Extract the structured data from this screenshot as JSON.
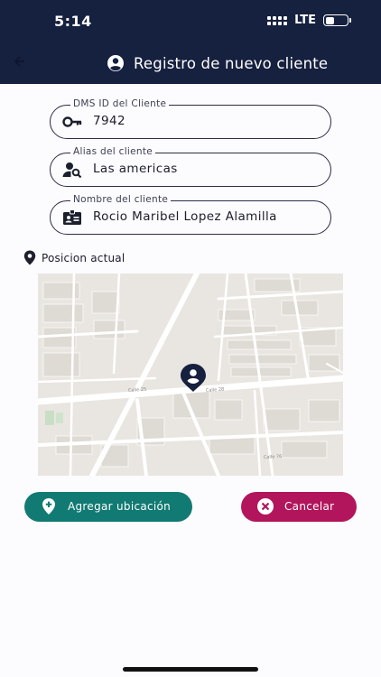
{
  "status_bar": {
    "time": "5:14",
    "network": "LTE",
    "battery_level": 0.3
  },
  "header": {
    "title": "Registro de nuevo cliente",
    "back_icon": "arrow-left-icon",
    "title_icon": "account-circle-icon"
  },
  "form": {
    "dms_id": {
      "label": "DMS ID del Cliente",
      "value": "7942",
      "icon": "key-icon"
    },
    "alias": {
      "label": "Alias del cliente",
      "value": "Las americas",
      "icon": "account-search-icon"
    },
    "name": {
      "label": "Nombre del cliente",
      "value": "Rocio Maribel Lopez Alamilla",
      "icon": "id-card-icon"
    }
  },
  "location": {
    "label": "Posicion actual",
    "icon": "map-marker-icon",
    "map_marker_icon": "account-pin-icon",
    "street_labels": [
      "Calle 25",
      "Calle 28",
      "Calle 76"
    ]
  },
  "actions": {
    "add_location": {
      "label": "Agregar ubicación",
      "icon": "map-marker-plus-icon",
      "color": "#117a72"
    },
    "cancel": {
      "label": "Cancelar",
      "icon": "close-circle-icon",
      "color": "#b2155c"
    }
  },
  "colors": {
    "header_bg": "#16203f",
    "page_bg": "#fcfbfe"
  }
}
